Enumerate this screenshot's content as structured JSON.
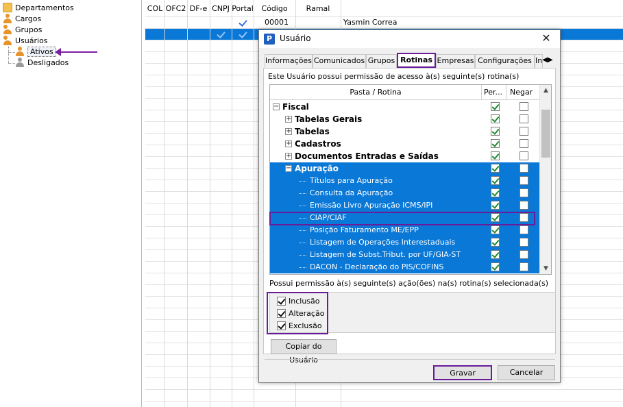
{
  "tree": {
    "items": [
      {
        "label": "Departamentos",
        "icon": "folder-icon"
      },
      {
        "label": "Cargos",
        "icon": "person-icon"
      },
      {
        "label": "Grupos",
        "icon": "group-icon"
      },
      {
        "label": "Usuários",
        "icon": "group-icon"
      },
      {
        "label": "Ativos",
        "icon": "person-icon"
      },
      {
        "label": "Desligados",
        "icon": "person-icon"
      }
    ]
  },
  "grid": {
    "columns": [
      "COL",
      "OFC2",
      "DF-e",
      "CNPJ",
      "Portal",
      "Código",
      "Ramal"
    ],
    "rows": [
      {
        "codigo": "00001",
        "name": "Yasmin Correa"
      }
    ]
  },
  "dialog": {
    "title": "Usuário",
    "close_glyph": "✕",
    "app_icon_letter": "P",
    "tabs": [
      "Informações",
      "Comunicados",
      "Grupos",
      "Rotinas",
      "Empresas",
      "Configurações",
      "In"
    ],
    "active_tab": "Rotinas",
    "permission_text": "Este Usuário possui permissão de acesso à(s) seguinte(s) rotina(s)",
    "routines_header": {
      "folder": "Pasta / Rotina",
      "perm": "Per...",
      "deny": "Negar"
    },
    "routines": [
      {
        "label": "Fiscal",
        "expander": "−",
        "perm": true,
        "deny": false
      },
      {
        "label": "Tabelas Gerais",
        "expander": "+",
        "perm": true,
        "deny": false
      },
      {
        "label": "Tabelas",
        "expander": "+",
        "perm": true,
        "deny": false
      },
      {
        "label": "Cadastros",
        "expander": "+",
        "perm": true,
        "deny": false
      },
      {
        "label": "Documentos Entradas e Saídas",
        "expander": "+",
        "perm": true,
        "deny": false
      },
      {
        "label": "Apuração",
        "expander": "−",
        "perm": true,
        "deny": false
      },
      {
        "label": "Títulos para Apuração",
        "perm": true,
        "deny": false
      },
      {
        "label": "Consulta da Apuração",
        "perm": true,
        "deny": false
      },
      {
        "label": "Emissão Livro Apuração ICMS/IPI",
        "perm": true,
        "deny": false
      },
      {
        "label": "CIAP/CIAF",
        "perm": true,
        "deny": false
      },
      {
        "label": "Posição Faturamento ME/EPP",
        "perm": true,
        "deny": false
      },
      {
        "label": "Listagem de Operações Interestaduais",
        "perm": true,
        "deny": false
      },
      {
        "label": "Listagem de Subst.Tribut. por UF/GIA-ST",
        "perm": true,
        "deny": false
      },
      {
        "label": "DACON - Declaração do PIS/COFINS",
        "perm": true,
        "deny": false
      }
    ],
    "actions_label": "Possui permissão à(s) seguinte(s) ação(ões) na(s) rotina(s) selecionada(s)",
    "actions": [
      {
        "label": "Inclusão",
        "checked": true
      },
      {
        "label": "Alteração",
        "checked": true
      },
      {
        "label": "Exclusão",
        "checked": true
      }
    ],
    "copy_button": "Copiar do Usuário",
    "save_button": "Gravar",
    "cancel_button": "Cancelar"
  },
  "colors": {
    "selection": "#0a78d7",
    "annotation": "#6a1b9a",
    "check_green": "#1a8a2a"
  }
}
